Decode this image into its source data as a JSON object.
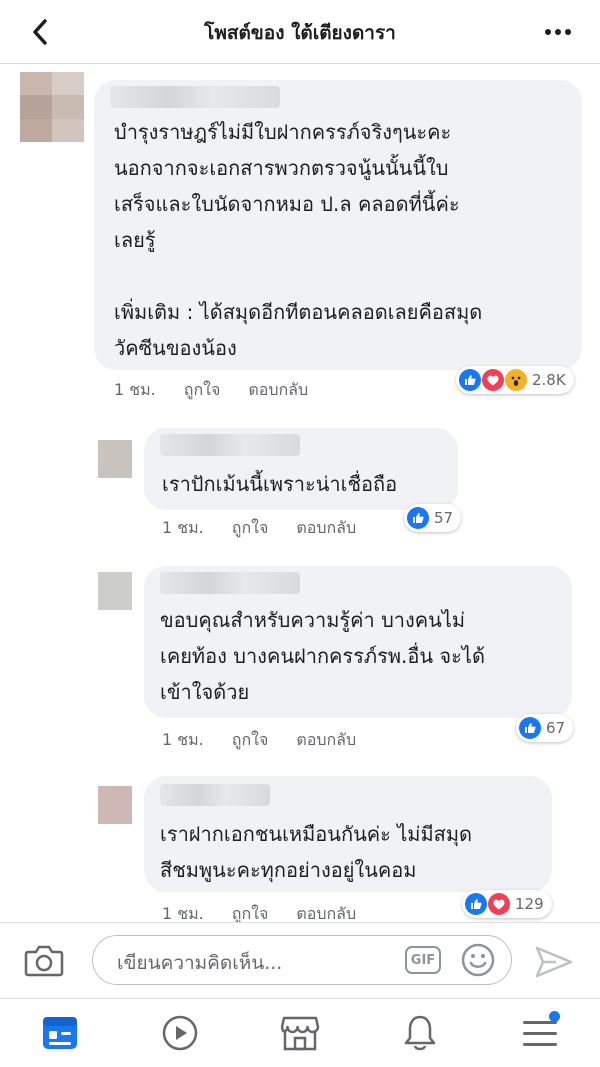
{
  "header": {
    "title": "โพสต์ของ ใต้เตียงดารา"
  },
  "comments": [
    {
      "text": "บำรุงราษฎร์ไม่มีใบฝากครรภ์จริงๆนะคะ\nนอกจากจะเอกสารพวกตรวจนู้นนั้นนี้ใบ\nเสร็จและใบนัดจากหมอ ป.ล คลอดที่นี้ค่ะ\nเลยรู้\n\nเพิ่มเติม : ได้สมุดอีกทีตอนคลอดเลยคือสมุด\nวัคซีนของน้อง",
      "time": "1 ชม.",
      "like": "ถูกใจ",
      "reply": "ตอบกลับ",
      "reactions": [
        "like",
        "love",
        "wow"
      ],
      "count": "2.8K"
    },
    {
      "text": "เราปักเม้นนี้เพราะน่าเชื่อถือ",
      "time": "1 ชม.",
      "like": "ถูกใจ",
      "reply": "ตอบกลับ",
      "reactions": [
        "like"
      ],
      "count": "57"
    },
    {
      "text": "ขอบคุณสำหรับความรู้ค่า บางคนไม่\nเคยท้อง บางคนฝากครรภ์รพ.อื่น จะได้\nเข้าใจด้วย",
      "time": "1 ชม.",
      "like": "ถูกใจ",
      "reply": "ตอบกลับ",
      "reactions": [
        "like"
      ],
      "count": "67"
    },
    {
      "text": "เราฝากเอกชนเหมือนกันค่ะ ไม่มีสมุด\nสีชมพูนะคะทุกอย่างอยู่ในคอม",
      "time": "1 ชม.",
      "like": "ถูกใจ",
      "reply": "ตอบกลับ",
      "reactions": [
        "like",
        "love"
      ],
      "count": "129"
    }
  ],
  "composer": {
    "placeholder": "เขียนความคิดเห็น...",
    "gif": "GIF"
  },
  "colors": {
    "accent": "#1877f2",
    "love": "#f33e58",
    "wow": "#f7b125",
    "bubble": "#f0f2f5"
  },
  "icons": [
    "back-arrow-icon",
    "more-icon",
    "camera-icon",
    "gif-icon",
    "emoji-icon",
    "send-icon",
    "news-feed-icon",
    "watch-icon",
    "marketplace-icon",
    "notifications-icon",
    "menu-icon"
  ]
}
